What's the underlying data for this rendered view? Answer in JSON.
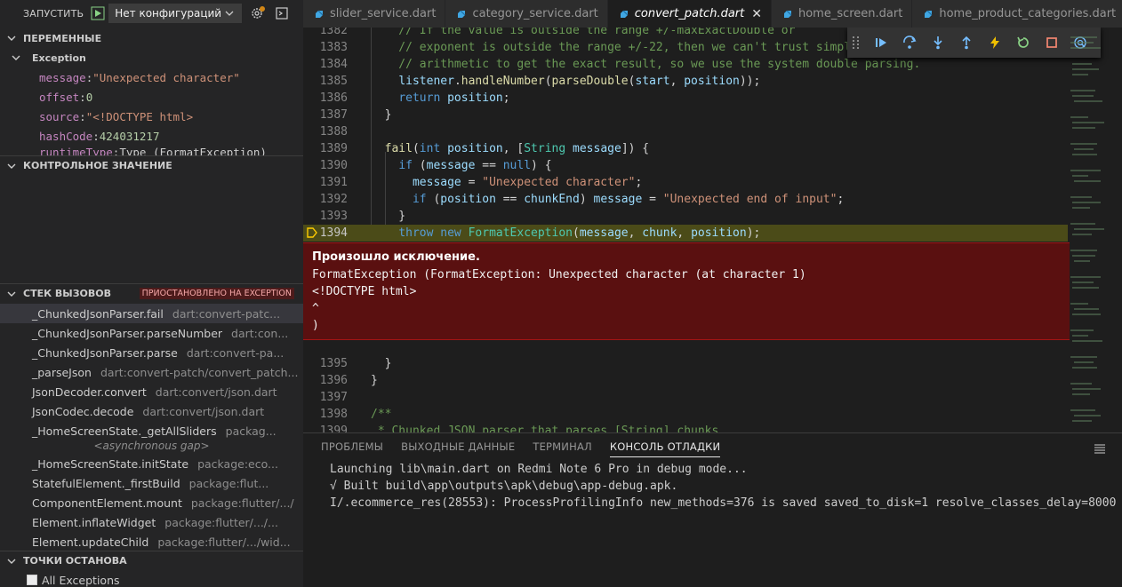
{
  "run_bar": {
    "label": "ЗАПУСТИТЬ",
    "config": "Нет конфигураций"
  },
  "variables": {
    "header": "ПЕРЕМЕННЫЕ",
    "scope": "Exception",
    "items": [
      {
        "name": "message",
        "value": "\"Unexpected character\"",
        "kind": "string"
      },
      {
        "name": "offset",
        "value": "0",
        "kind": "number"
      },
      {
        "name": "source",
        "value": "\"<!DOCTYPE html>",
        "kind": "string"
      },
      {
        "name": "hashCode",
        "value": "424031217",
        "kind": "number"
      },
      {
        "name": "runtimeType",
        "value": "Type (FormatException)",
        "kind": "plain"
      }
    ]
  },
  "watch": {
    "header": "КОНТРОЛЬНОЕ ЗНАЧЕНИЕ"
  },
  "callstack": {
    "header": "СТЕК ВЫЗОВОВ",
    "badge": "ПРИОСТАНОВЛЕНО НА EXCEPTION",
    "frames": [
      {
        "fn": "_ChunkedJsonParser.fail",
        "src": "dart:convert-patc..."
      },
      {
        "fn": "_ChunkedJsonParser.parseNumber",
        "src": "dart:con..."
      },
      {
        "fn": "_ChunkedJsonParser.parse",
        "src": "dart:convert-pa..."
      },
      {
        "fn": "_parseJson",
        "src": "dart:convert-patch/convert_patch..."
      },
      {
        "fn": "JsonDecoder.convert",
        "src": "dart:convert/json.dart"
      },
      {
        "fn": "JsonCodec.decode",
        "src": "dart:convert/json.dart"
      },
      {
        "fn": "_HomeScreenState._getAllSliders",
        "src": "packag..."
      }
    ],
    "async_gap": "<asynchronous gap>",
    "frames2": [
      {
        "fn": "_HomeScreenState.initState",
        "src": "package:eco..."
      },
      {
        "fn": "StatefulElement._firstBuild",
        "src": "package:flut..."
      },
      {
        "fn": "ComponentElement.mount",
        "src": "package:flutter/.../"
      },
      {
        "fn": "Element.inflateWidget",
        "src": "package:flutter/.../..."
      },
      {
        "fn": "Element.updateChild",
        "src": "package:flutter/.../wid..."
      }
    ]
  },
  "breakpoints": {
    "header": "ТОЧКИ ОСТАНОВА",
    "all_exceptions": "All Exceptions"
  },
  "tabs": [
    {
      "label": "slider_service.dart",
      "active": false
    },
    {
      "label": "category_service.dart",
      "active": false
    },
    {
      "label": "convert_patch.dart",
      "active": true
    },
    {
      "label": "home_screen.dart",
      "active": false
    },
    {
      "label": "home_product_categories.dart",
      "active": false
    }
  ],
  "editor": {
    "lines": [
      {
        "n": "1382",
        "text": "    // If the value is outside the range +/-maxExactDouble or"
      },
      {
        "n": "1383",
        "text": "    // exponent is outside the range +/-22, then we can't trust simple"
      },
      {
        "n": "1384",
        "text": "    // arithmetic to get the exact result, so we use the system double parsing."
      },
      {
        "n": "1385",
        "text": "    listener.handleNumber(parseDouble(start, position));"
      },
      {
        "n": "1386",
        "text": "    return position;"
      },
      {
        "n": "1387",
        "text": "  }"
      },
      {
        "n": "1388",
        "text": ""
      },
      {
        "n": "1389",
        "text": "  fail(int position, [String message]) {"
      },
      {
        "n": "1390",
        "text": "    if (message == null) {"
      },
      {
        "n": "1391",
        "text": "      message = \"Unexpected character\";"
      },
      {
        "n": "1392",
        "text": "      if (position == chunkEnd) message = \"Unexpected end of input\";"
      },
      {
        "n": "1393",
        "text": "    }"
      },
      {
        "n": "1394",
        "text": "    throw new FormatException(message, chunk, position);"
      }
    ],
    "lines_after": [
      {
        "n": "1395",
        "text": "  }"
      },
      {
        "n": "1396",
        "text": "}"
      },
      {
        "n": "1397",
        "text": ""
      },
      {
        "n": "1398",
        "text": "/**"
      },
      {
        "n": "1399",
        "text": " * Chunked JSON parser that parses [String] chunks."
      }
    ],
    "exception": {
      "title": "Произошло исключение.",
      "body": "FormatException (FormatException: Unexpected character (at character 1)\n<!DOCTYPE html>\n^\n)"
    }
  },
  "panel": {
    "tabs": [
      "ПРОБЛЕМЫ",
      "ВЫХОДНЫЕ ДАННЫЕ",
      "ТЕРМИНАЛ",
      "КОНСОЛЬ ОТЛАДКИ"
    ],
    "active_tab": 3,
    "console": [
      "Launching lib\\main.dart on Redmi Note 6 Pro in debug mode...",
      "√ Built build\\app\\outputs\\apk\\debug\\app-debug.apk.",
      "I/.ecommerce_res(28553): ProcessProfilingInfo new_methods=376 is saved saved_to_disk=1 resolve_classes_delay=8000"
    ]
  },
  "colors": {
    "accent": "#007acc",
    "exception_bg": "#5a1010",
    "current_line": "#4b4b18",
    "badge_bg": "#4d1b1b"
  }
}
